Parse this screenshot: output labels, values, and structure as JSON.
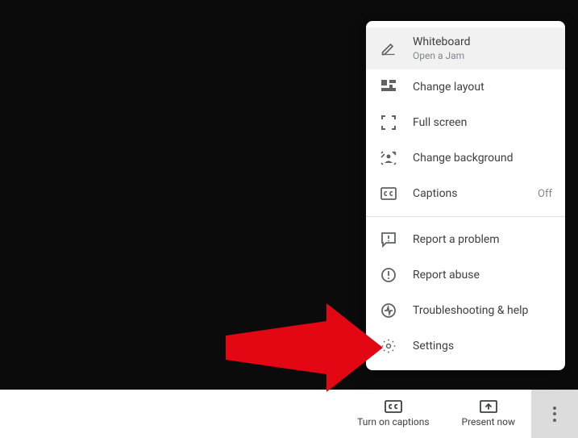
{
  "menu": {
    "section1": [
      {
        "label": "Whiteboard",
        "sublabel": "Open a Jam",
        "icon": "pencil-icon",
        "highlighted": true
      },
      {
        "label": "Change layout",
        "icon": "layout-icon"
      },
      {
        "label": "Full screen",
        "icon": "fullscreen-icon"
      },
      {
        "label": "Change background",
        "icon": "background-icon"
      },
      {
        "label": "Captions",
        "right": "Off",
        "icon": "captions-icon"
      }
    ],
    "section2": [
      {
        "label": "Report a problem",
        "icon": "feedback-icon"
      },
      {
        "label": "Report abuse",
        "icon": "alert-icon"
      },
      {
        "label": "Troubleshooting & help",
        "icon": "activity-icon"
      },
      {
        "label": "Settings",
        "icon": "gear-icon"
      }
    ]
  },
  "bottomBar": {
    "captions": "Turn on captions",
    "present": "Present now"
  },
  "annotation": {
    "arrow_color": "#e30613"
  }
}
